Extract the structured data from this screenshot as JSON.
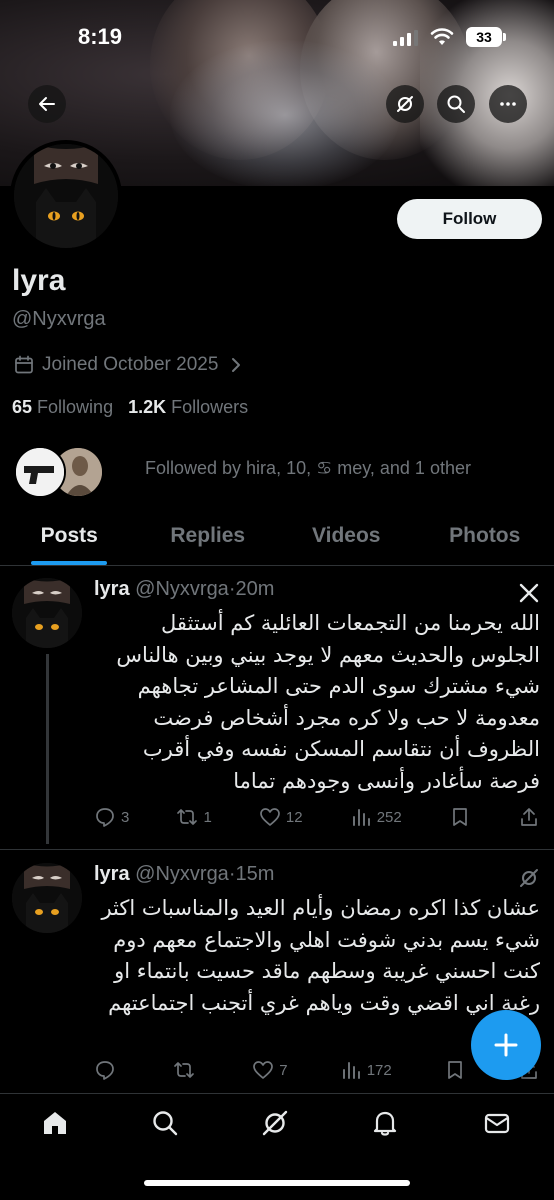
{
  "status_bar": {
    "time": "8:19",
    "battery": "33"
  },
  "profile": {
    "display_name": "lyra",
    "handle": "@Nyxvrga",
    "joined": "Joined October 2025",
    "following_count": "65",
    "following_label": "Following",
    "followers_count": "1.2K",
    "followers_label": "Followers",
    "followed_by": "Followed by hira, 10, ♋︎ mey, and 1 other",
    "follow_button": "Follow"
  },
  "tabs": [
    {
      "label": "Posts",
      "active": true
    },
    {
      "label": "Replies",
      "active": false
    },
    {
      "label": "Videos",
      "active": false
    },
    {
      "label": "Photos",
      "active": false
    }
  ],
  "posts": [
    {
      "name": "lyra",
      "handle": "@Nyxvrga",
      "separator": "·",
      "time": "20m",
      "text": "الله يحرمنا من التجمعات العائلية كم أستثقل الجلوس والحديث معهم لا يوجد بيني وبين هالناس شيء مشترك سوى الدم حتى المشاعر تجاههم معدومة لا حب ولا كره مجرد أشخاص فرضت الظروف أن نتقاسم المسكن نفسه وفي أقرب فرصة سأغادر وأنسى وجودهم تماما",
      "replies": "3",
      "reposts": "1",
      "likes": "12",
      "views": "252"
    },
    {
      "name": "lyra",
      "handle": "@Nyxvrga",
      "separator": "·",
      "time": "15m",
      "text": "عشان كذا اكره رمضان وأيام العيد والمناسبات اكثر شيء يسم بدني شوفت اهلي والاجتماع معهم دوم كنت احسني غريبة وسطهم ماقد حسيت بانتماء او رغبة اني اقضي وقت وياهم غري أتجنب اجتماعتهم",
      "replies": "",
      "reposts": "",
      "likes": "7",
      "views": "172"
    }
  ],
  "colors": {
    "accent": "#1d9bf0",
    "background": "#000000",
    "muted": "#71767b",
    "text": "#e7e9ea"
  }
}
